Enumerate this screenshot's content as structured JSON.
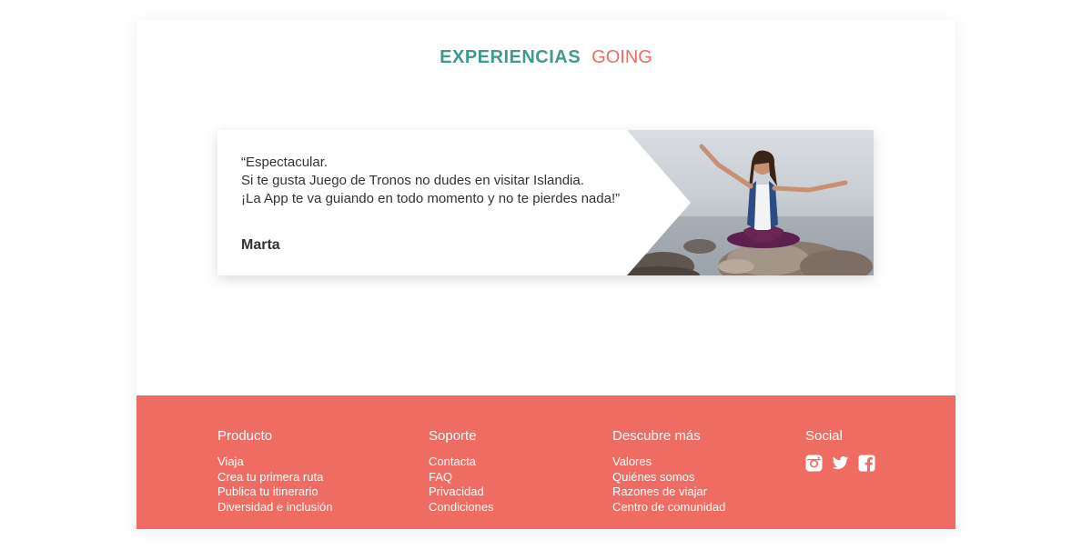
{
  "header": {
    "title": "EXPERIENCIAS",
    "brand": "GOING"
  },
  "testimonial": {
    "quote_lines": [
      "“Espectacular.",
      "Si te gusta Juego de Tronos no dudes en visitar Islandia.",
      "¡La App te va guiando en todo momento y no te pierdes nada!”"
    ],
    "author": "Marta"
  },
  "footer": {
    "producto": {
      "heading": "Producto",
      "links": [
        "Viaja",
        "Crea tu primera ruta",
        "Publica tu itinerario",
        "Diversidad e inclusión"
      ]
    },
    "soporte": {
      "heading": "Soporte",
      "links": [
        "Contacta",
        "FAQ",
        "Privacidad",
        "Condiciones"
      ]
    },
    "descubre": {
      "heading": "Descubre más",
      "links": [
        "Valores",
        "Quiénes somos",
        "Razones de viajar",
        "Centro de comunidad"
      ]
    },
    "social": {
      "heading": "Social",
      "icons": [
        "instagram-icon",
        "twitter-icon",
        "facebook-icon"
      ]
    }
  },
  "colors": {
    "teal": "#3f9a8d",
    "coral": "#ee6c62",
    "text": "#333333"
  }
}
